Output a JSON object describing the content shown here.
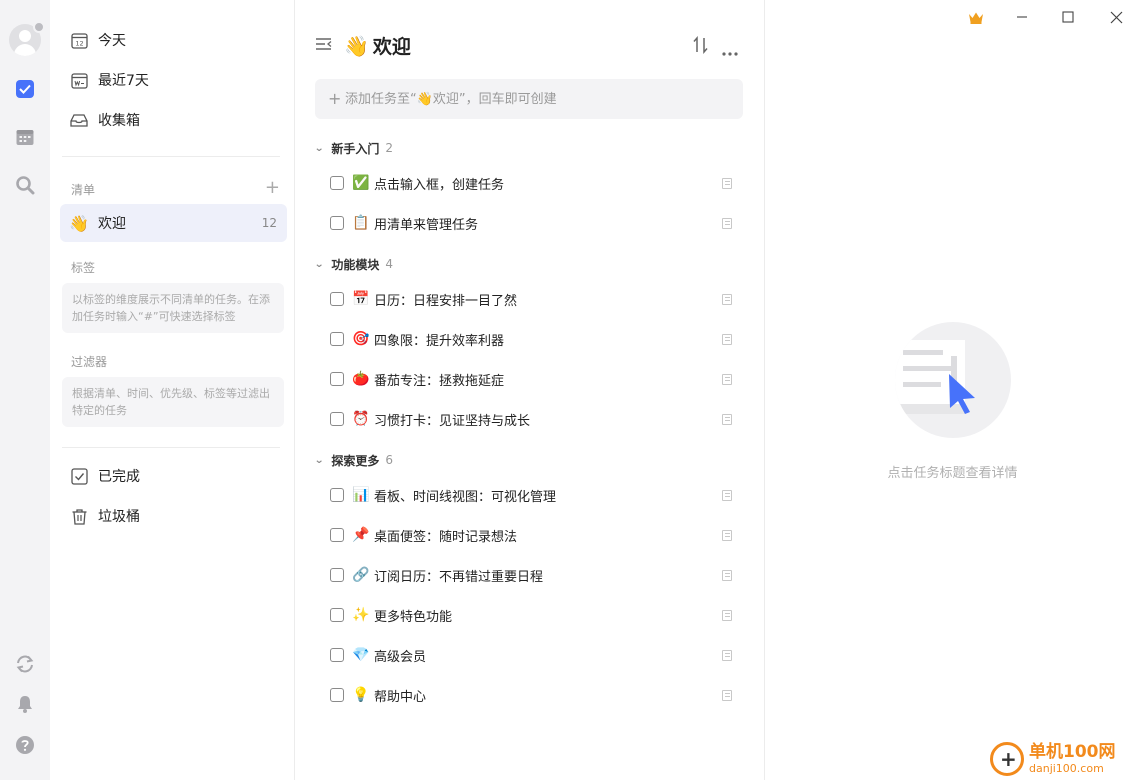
{
  "sidebar": {
    "nav": [
      {
        "label": "今天",
        "icon": "calendar-today-icon",
        "day": "12"
      },
      {
        "label": "最近7天",
        "icon": "calendar-week-icon"
      },
      {
        "label": "收集箱",
        "icon": "inbox-icon"
      }
    ],
    "lists_label": "清单",
    "lists": [
      {
        "label": "欢迎",
        "emoji": "👋",
        "count": "12",
        "active": true
      }
    ],
    "tags_label": "标签",
    "tags_hint": "以标签的维度展示不同清单的任务。在添加任务时输入“#”可快速选择标签",
    "filters_label": "过滤器",
    "filters_hint": "根据清单、时间、优先级、标签等过滤出特定的任务",
    "bottom": [
      {
        "label": "已完成",
        "icon": "completed-icon"
      },
      {
        "label": "垃圾桶",
        "icon": "trash-icon"
      }
    ]
  },
  "main": {
    "title": "欢迎",
    "title_emoji": "👋",
    "add_placeholder": "添加任务至“👋欢迎”，回车即可创建",
    "groups": [
      {
        "name": "新手入门",
        "count": "2",
        "tasks": [
          {
            "emoji": "✅",
            "text": "点击输入框，创建任务"
          },
          {
            "emoji": "📋",
            "text": "用清单来管理任务"
          }
        ]
      },
      {
        "name": "功能模块",
        "count": "4",
        "tasks": [
          {
            "emoji": "📅",
            "text": "日历：日程安排一目了然"
          },
          {
            "emoji": "🎯",
            "text": "四象限：提升效率利器"
          },
          {
            "emoji": "🍅",
            "text": "番茄专注：拯救拖延症"
          },
          {
            "emoji": "⏰",
            "text": "习惯打卡：见证坚持与成长"
          }
        ]
      },
      {
        "name": "探索更多",
        "count": "6",
        "tasks": [
          {
            "emoji": "📊",
            "text": "看板、时间线视图：可视化管理"
          },
          {
            "emoji": "📌",
            "text": "桌面便签：随时记录想法"
          },
          {
            "emoji": "🔗",
            "text": "订阅日历：不再错过重要日程"
          },
          {
            "emoji": "✨",
            "text": "更多特色功能"
          },
          {
            "emoji": "💎",
            "text": "高级会员"
          },
          {
            "emoji": "💡",
            "text": "帮助中心"
          }
        ]
      }
    ]
  },
  "detail": {
    "empty_text": "点击任务标题查看详情"
  },
  "watermark": {
    "name": "单机100网",
    "url": "danji100.com"
  },
  "colors": {
    "accent": "#4772fa",
    "crown": "#f0a020"
  }
}
